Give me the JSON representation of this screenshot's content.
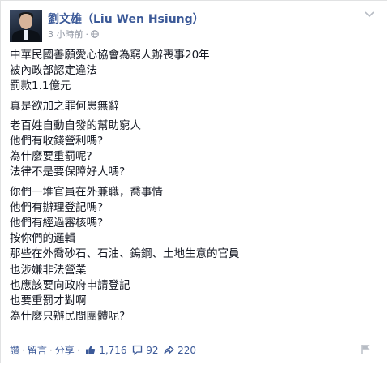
{
  "post": {
    "author": "劉文雄（Liu Wen Hsiung）",
    "time": "3 小時前",
    "dot": "·",
    "paragraphs": [
      [
        "中華民國善願愛心協會為窮人辦喪事20年",
        "被內政部認定違法",
        "罰款1.1億元"
      ],
      [
        "真是欲加之罪何患無辭"
      ],
      [
        "老百姓自動自發的幫助窮人",
        "他們有收錢營利嗎?",
        "為什麼要重罰呢?",
        "法律不是要保障好人嗎?"
      ],
      [
        "你們一堆官員在外兼職，喬事情",
        "他們有辦理登記嗎?",
        "他們有經過審核嗎?",
        "按你們的邏輯",
        "那些在外喬砂石、石油、鎢鋼、土地生意的官員",
        "也涉嫌非法營業",
        "也應該要向政府申請登記",
        "也要重罰才對啊",
        "為什麼只辦民間團體呢?"
      ]
    ]
  },
  "actions": {
    "like": "讚",
    "comment": "留言",
    "share": "分享",
    "sep": "·",
    "like_count": "1,716",
    "comment_count": "92",
    "share_count": "220"
  },
  "icons": {
    "globe": "globe-icon",
    "chevron": "chevron-down-icon",
    "thumb": "thumbs-up-icon",
    "bubble": "comment-icon",
    "share_arrow": "share-arrow-icon",
    "flag": "flag-icon"
  },
  "colors": {
    "link": "#3b5998",
    "meta": "#9197a3",
    "text": "#141823"
  }
}
